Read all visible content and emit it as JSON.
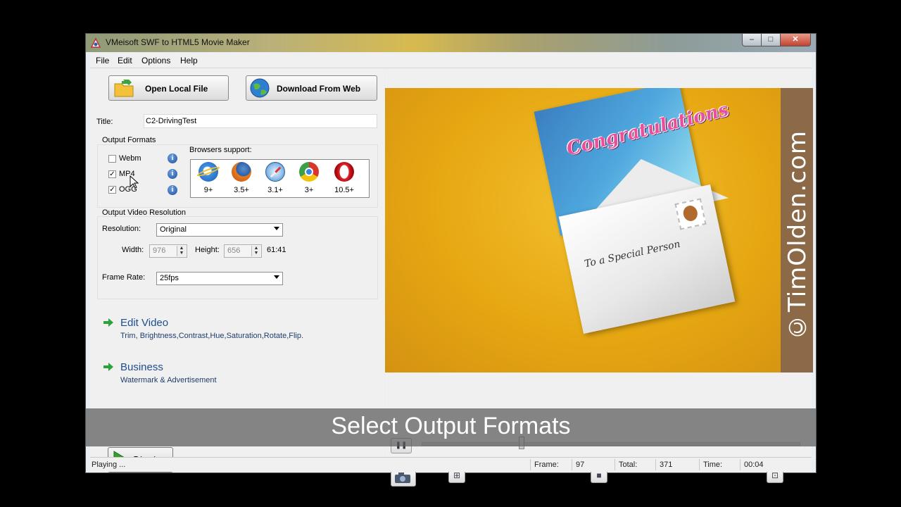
{
  "window": {
    "title": "VMeisoft SWF to HTML5 Movie Maker",
    "min": "–",
    "max": "□",
    "close": "✕"
  },
  "menu": [
    "File",
    "Edit",
    "Options",
    "Help"
  ],
  "toolbar": {
    "open_label": "Open Local File",
    "web_label": "Download From Web"
  },
  "title_field": {
    "label": "Title:",
    "value": "C2-DrivingTest"
  },
  "output_formats": {
    "legend": "Output Formats",
    "items": [
      {
        "label": "Webm",
        "checked": false
      },
      {
        "label": "MP4",
        "checked": true
      },
      {
        "label": "OGG",
        "checked": true
      }
    ],
    "info_glyph": "i",
    "browsers_label": "Browsers support:",
    "browsers": [
      {
        "icon": "internet-explorer-icon",
        "version": "9+",
        "color": "#2b78d6"
      },
      {
        "icon": "firefox-icon",
        "version": "3.5+",
        "color": "#e46d1c"
      },
      {
        "icon": "safari-icon",
        "version": "3.1+",
        "color": "#3b8fd9"
      },
      {
        "icon": "chrome-icon",
        "version": "3+",
        "color": "#d8352d"
      },
      {
        "icon": "opera-icon",
        "version": "10.5+",
        "color": "#cc0f16"
      }
    ]
  },
  "resolution": {
    "legend": "Output Video Resolution",
    "resolution_label": "Resolution:",
    "resolution_value": "Original",
    "width_label": "Width:",
    "width_value": "976",
    "height_label": "Height:",
    "height_value": "656",
    "ratio": "61:41",
    "framerate_label": "Frame Rate:",
    "framerate_value": "25fps"
  },
  "sections": [
    {
      "title": "Edit Video",
      "subtitle": "Trim, Brightness,Contrast,Hue,Saturation,Rotate,Flip."
    },
    {
      "title": "Business",
      "subtitle": "Watermark & Advertisement"
    }
  ],
  "start_label": "Start",
  "preview": {
    "watermark": "©TimOlden.com",
    "card_text": "Congratulations",
    "envelope_text": "To a Special Person"
  },
  "status": {
    "state": "Playing ...",
    "frame_label": "Frame:",
    "frame_value": "97",
    "total_label": "Total:",
    "total_value": "371",
    "time_label": "Time:",
    "time_value": "00:04"
  },
  "caption": "Select Output Formats"
}
